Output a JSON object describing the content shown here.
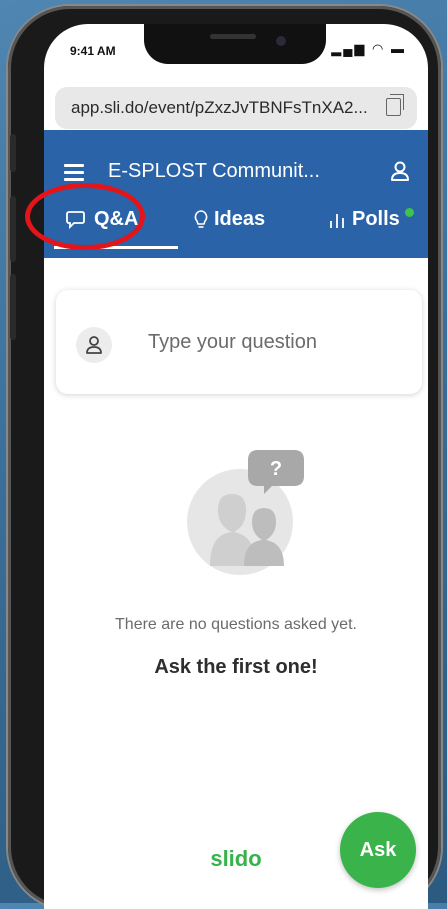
{
  "status": {
    "time": "9:41 AM",
    "signal_icons": "▂▄▆ ◠ ▬"
  },
  "browser": {
    "url": "app.sli.do/event/pZxzJvTBNFsTnXA2..."
  },
  "header": {
    "title": "E-SPLOST Communit..."
  },
  "tabs": [
    {
      "label": "Q&A",
      "icon": "chat-bubbles-icon",
      "active": true
    },
    {
      "label": "Ideas",
      "icon": "lightbulb-icon"
    },
    {
      "label": "Polls",
      "icon": "bar-chart-icon",
      "badge": "new-dot"
    }
  ],
  "question": {
    "placeholder": "Type your question"
  },
  "empty_state": {
    "message": "There are no questions asked yet.",
    "cta": "Ask the first one!",
    "bubble_glyph": "?"
  },
  "footer": {
    "brand": "slido"
  },
  "ask_button": {
    "label": "Ask"
  },
  "colors": {
    "primary": "#2a63a8",
    "accent": "#39b34a",
    "highlight": "#e3151b"
  }
}
